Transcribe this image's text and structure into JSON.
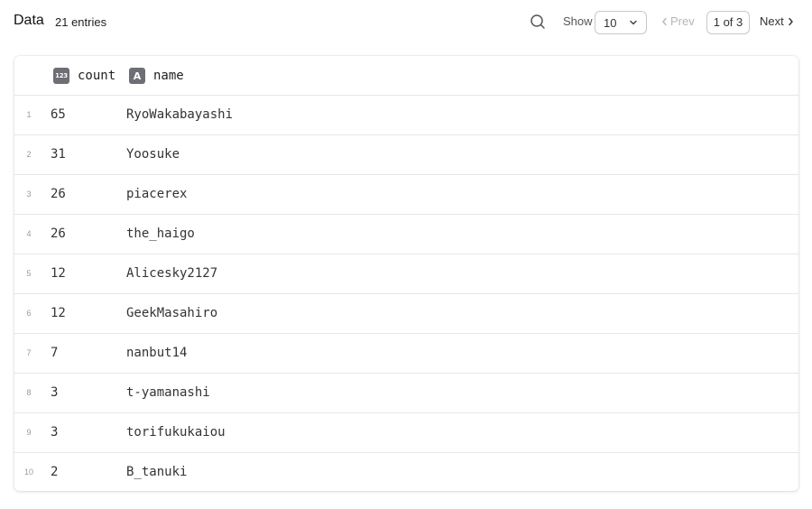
{
  "header": {
    "title": "Data",
    "entries": "21 entries"
  },
  "toolbar": {
    "search_icon": "search-icon",
    "show_label": "Show",
    "page_size": "10",
    "prev_label": "Prev",
    "page_indicator": "1 of 3",
    "next_label": "Next"
  },
  "table": {
    "columns": [
      {
        "label": "count",
        "type_badge": "123"
      },
      {
        "label": "name",
        "type_badge": "A"
      }
    ],
    "rows": [
      {
        "index": "1",
        "count": "65",
        "name": "RyoWakabayashi"
      },
      {
        "index": "2",
        "count": "31",
        "name": "Yoosuke"
      },
      {
        "index": "3",
        "count": "26",
        "name": "piacerex"
      },
      {
        "index": "4",
        "count": "26",
        "name": "the_haigo"
      },
      {
        "index": "5",
        "count": "12",
        "name": "Alicesky2127"
      },
      {
        "index": "6",
        "count": "12",
        "name": "GeekMasahiro"
      },
      {
        "index": "7",
        "count": "7",
        "name": "nanbut14"
      },
      {
        "index": "8",
        "count": "3",
        "name": "t-yamanashi"
      },
      {
        "index": "9",
        "count": "3",
        "name": "torifukukaiou"
      },
      {
        "index": "10",
        "count": "2",
        "name": "B_tanuki"
      }
    ]
  },
  "colors": {
    "badge": "#6e6e76",
    "border": "#e6e6e9",
    "disabled_text": "#b5b5ba"
  }
}
